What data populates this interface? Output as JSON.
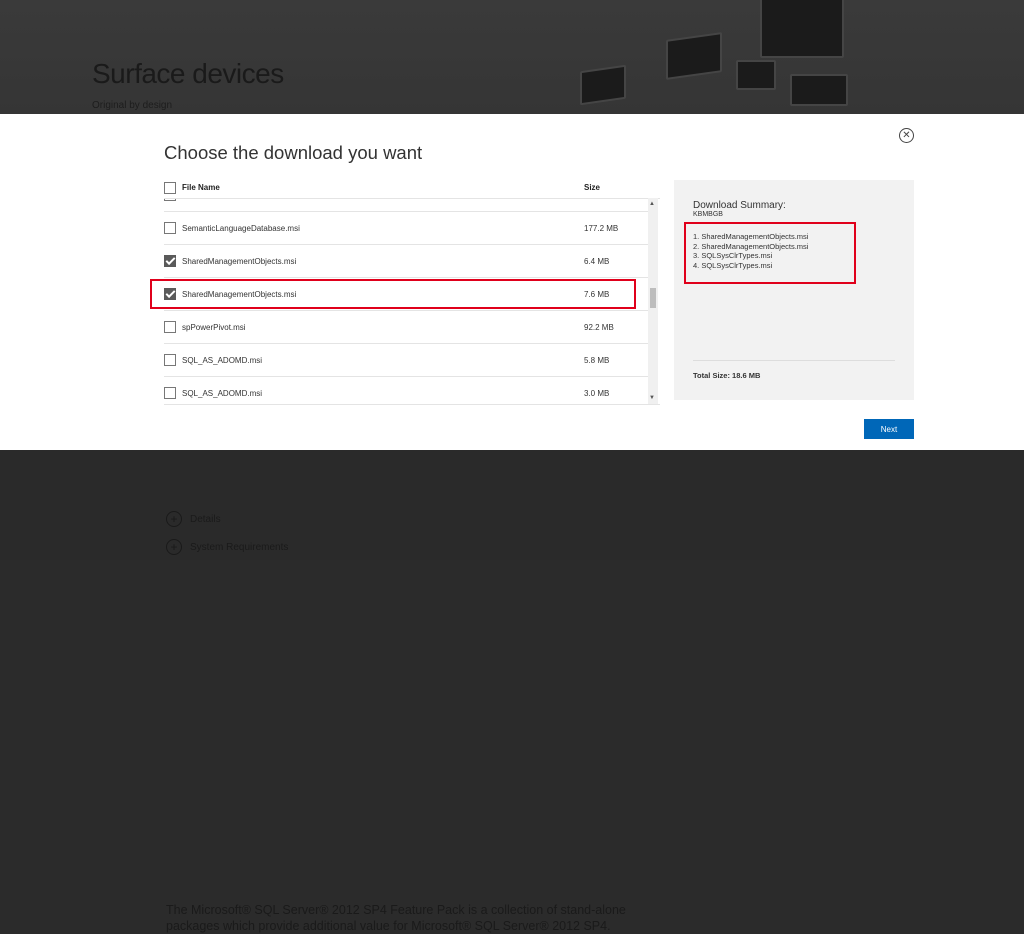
{
  "background": {
    "title": "Surface devices",
    "subtitle": "Original by design",
    "description": "The Microsoft® SQL Server® 2012 SP4 Feature Pack is a collection of stand-alone packages which provide additional value for Microsoft® SQL Server® 2012 SP4.",
    "links": [
      {
        "label": "Details",
        "icon": "plus-circle-icon"
      },
      {
        "label": "System Requirements",
        "icon": "plus-circle-icon"
      }
    ]
  },
  "modal": {
    "title": "Choose the download you want",
    "close_icon": "close-circle-icon",
    "columns": {
      "name": "File Name",
      "size": "Size"
    },
    "rows": [
      {
        "name": "SemanticLanguageDatabase.msi",
        "size": "177.2 MB",
        "checked": false
      },
      {
        "name": "SharedManagementObjects.msi",
        "size": "6.4 MB",
        "checked": true
      },
      {
        "name": "SharedManagementObjects.msi",
        "size": "7.6 MB",
        "checked": true
      },
      {
        "name": "spPowerPivot.msi",
        "size": "92.2 MB",
        "checked": false
      },
      {
        "name": "SQL_AS_ADOMD.msi",
        "size": "5.8 MB",
        "checked": false
      },
      {
        "name": "SQL_AS_ADOMD.msi",
        "size": "3.0 MB",
        "checked": false
      }
    ],
    "summary": {
      "title": "Download Summary:",
      "kb": "KBMBGB",
      "items": [
        "1. SharedManagementObjects.msi",
        "2. SharedManagementObjects.msi",
        "3. SQLSysClrTypes.msi",
        "4. SQLSysClrTypes.msi"
      ],
      "total": "Total Size: 18.6 MB"
    },
    "next_label": "Next"
  },
  "colors": {
    "accent": "#0067b8",
    "highlight": "#e0001b",
    "overlay": "#2b2b2b"
  }
}
